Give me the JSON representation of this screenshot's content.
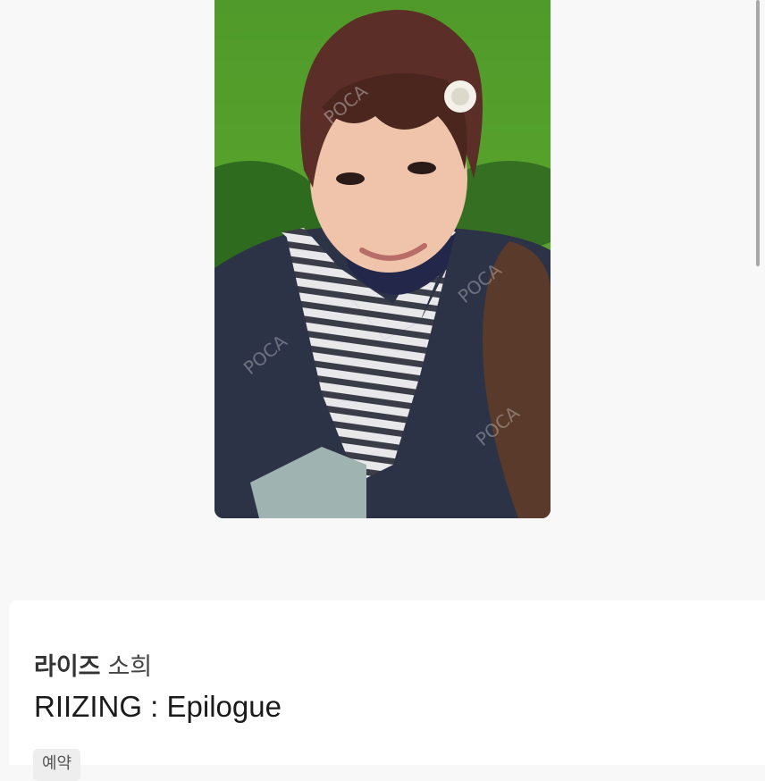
{
  "card": {
    "watermark": "POCA",
    "alt": "photocard"
  },
  "product": {
    "group_name": "라이즈",
    "member_name": "소희",
    "album_title": "RIIZING : Epilogue",
    "tag_label": "예약"
  },
  "colors": {
    "page_background": "#f8f8f8",
    "panel_background": "#ffffff",
    "tag_background": "#eeeeee"
  }
}
